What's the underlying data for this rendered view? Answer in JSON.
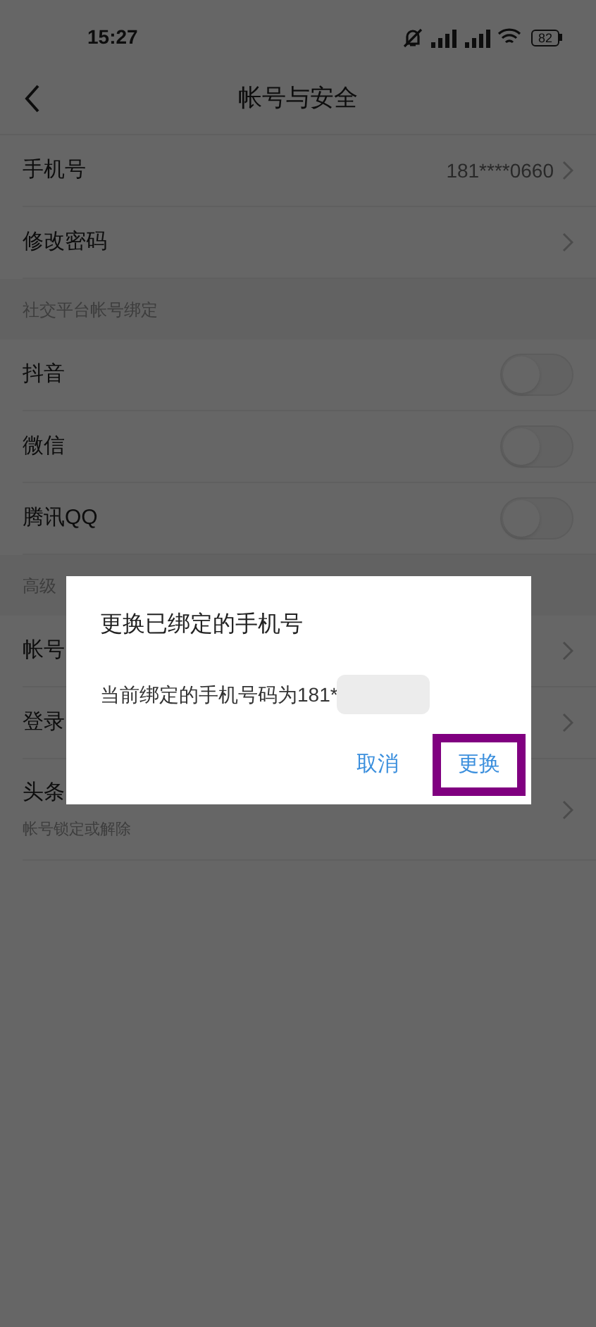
{
  "status_bar": {
    "time": "15:27",
    "battery": "82"
  },
  "header": {
    "title": "帐号与安全"
  },
  "sections": [
    {
      "rows": [
        {
          "kind": "link",
          "label": "手机号",
          "value": "181****0660"
        },
        {
          "kind": "link",
          "label": "修改密码"
        }
      ]
    },
    {
      "heading": "社交平台帐号绑定",
      "rows": [
        {
          "kind": "toggle",
          "label": "抖音",
          "checked": false
        },
        {
          "kind": "toggle",
          "label": "微信",
          "checked": false
        },
        {
          "kind": "toggle",
          "label": "腾讯QQ",
          "checked": false
        }
      ]
    },
    {
      "heading": "高级",
      "rows": [
        {
          "kind": "link",
          "label": "帐号"
        },
        {
          "kind": "link",
          "label": "登录"
        },
        {
          "kind": "link",
          "label": "头条",
          "subtitle": "帐号锁定或解除"
        }
      ]
    }
  ],
  "dialog": {
    "title": "更换已绑定的手机号",
    "message": "当前绑定的手机号码为181*",
    "buttons": [
      {
        "label": "取消",
        "highlighted": false
      },
      {
        "label": "更换",
        "highlighted": true
      }
    ]
  }
}
